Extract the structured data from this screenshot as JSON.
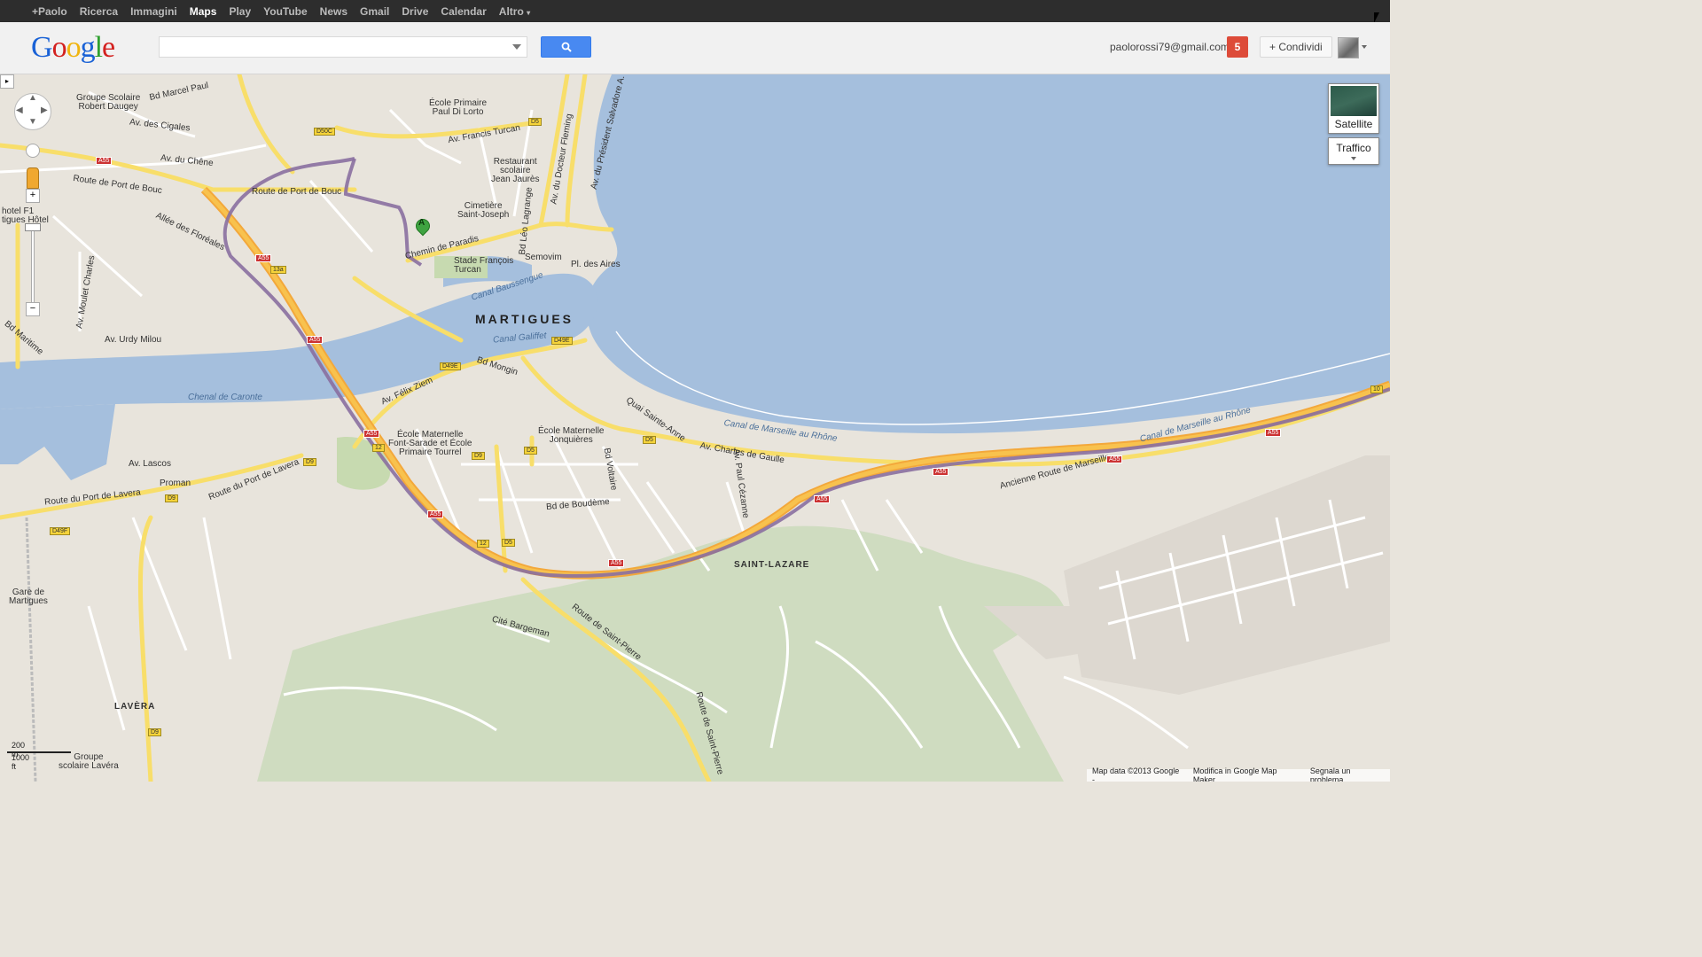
{
  "topnav": {
    "items": [
      {
        "label": "+Paolo"
      },
      {
        "label": "Ricerca"
      },
      {
        "label": "Immagini"
      },
      {
        "label": "Maps"
      },
      {
        "label": "Play"
      },
      {
        "label": "YouTube"
      },
      {
        "label": "News"
      },
      {
        "label": "Gmail"
      },
      {
        "label": "Drive"
      },
      {
        "label": "Calendar"
      },
      {
        "label": "Altro"
      }
    ],
    "active": "Maps",
    "more_caret": "▾"
  },
  "header": {
    "logo": [
      "G",
      "o",
      "o",
      "g",
      "l",
      "e"
    ],
    "logo_colors": [
      "#1a62d6",
      "#d3211f",
      "#f0b40f",
      "#1a62d6",
      "#2ea02f",
      "#d3211f"
    ],
    "search_value": "",
    "search_placeholder": "",
    "email": "paolorossi79@gmail.com",
    "notification_count": "5",
    "share_label": "+ Condividi",
    "search_button_color": "#4889f1"
  },
  "map_controls": {
    "satellite_label": "Satellite",
    "traffic_label": "Traffico",
    "zoom_in": "+",
    "zoom_out": "−",
    "scale_metric": "200 m",
    "scale_imperial": "1000 ft",
    "marker_label": "A"
  },
  "map_labels": {
    "city": "MARTIGUES",
    "saint_lazare": "SAINT-LAZARE",
    "lavera": "LAVÈRA",
    "route_port_bouc": "Route de Port de Bouc",
    "route_port_bouc2": "Route de Port de Bouc",
    "bd_marcel_paul": "Bd Marcel Paul",
    "av_francis_turcan": "Av. Francis Turcan",
    "chemin_paradis": "Chemin de Paradis",
    "canal_baussengue": "Canal Baussengue",
    "canal_galiffet": "Canal Galiffet",
    "chenal_caronte": "Chenal de Caronte",
    "canal_marseille1": "Canal de Marseille au Rhône",
    "canal_marseille2": "Canal de Marseille au Rhône",
    "av_charles_gaulle": "Av. Charles de Gaulle",
    "ancienne_route": "Ancienne Route de Marseille",
    "route_saint_pierre": "Route de Saint-Pierre",
    "route_saint_pierre2": "Route de Saint-Pierre",
    "route_port_lavera": "Route du Port de Lavera",
    "route_port_lavera2": "Route du Port de Lavera",
    "av_felix_ziem": "Av. Félix Ziem",
    "bd_mongin": "Bd Mongin",
    "semovim": "Semovim",
    "stade": "Stade François\nTurcan",
    "cimetiere": "Cimetière\nSaint-Joseph",
    "ecole_primaire": "École Primaire\nPaul Di Lorto",
    "restaurant": "Restaurant\nscolaire\nJean Jaurès",
    "groupe_scolaire": "Groupe Scolaire\nRobert Daugey",
    "ecole_font_sarade": "École Maternelle\nFont-Sarade et École\nPrimaire Tourrel",
    "ecole_jonquieres": "École Maternelle\nJonquières",
    "gare": "Gare de\nMartigues",
    "proman": "Proman",
    "av_lascos": "Av. Lascos",
    "av_urdy_milou": "Av. Urdy Milou",
    "bd_maritime": "Bd Maritime",
    "av_moulet": "Av. Moulet Charles",
    "av_cigales": "Av. des Cigales",
    "av_chene": "Av. du Chêne",
    "allee_floreales": "Allée des Floréales",
    "hotel": "hotel F1\ntigues Hôtel",
    "pl_aires": "Pl. des Aires",
    "quai_sainte_anne": "Quai Sainte-Anne",
    "bd_boudeme": "Bd de Boudème",
    "cite_bargeman": "Cité Bargeman",
    "bd_voltaire": "Bd Voltaire",
    "av_paul_cezanne": "Av. Paul Cézanne",
    "bd_lea_lagrange": "Bd Léo Lagrange",
    "av_docteur_fleming": "Av. du Docteur Fleming",
    "av_pres_salvadore": "Av. du Président Salvadore A.",
    "groupe_lavera": "Groupe\nscolaire Lavéra"
  },
  "road_shields": [
    "A55",
    "A55",
    "A55",
    "A55",
    "A55",
    "A55",
    "A55",
    "A55",
    "A55",
    "A55",
    "D5",
    "D5",
    "D5",
    "D5",
    "D9",
    "D9",
    "D9",
    "D9",
    "D49E",
    "D49E",
    "D49F",
    "D50C",
    "13a",
    "12",
    "12",
    "10"
  ],
  "footer": {
    "map_data": "Map data ©2013 Google -",
    "map_maker": "Modifica in Google Map Maker",
    "report": "Segnala un problema"
  },
  "colors": {
    "water": "#a5bfdd",
    "land": "#e8e4dc",
    "highway": "#f8c24e",
    "route": "#8a6fa0",
    "green": "#cfdcc0"
  }
}
